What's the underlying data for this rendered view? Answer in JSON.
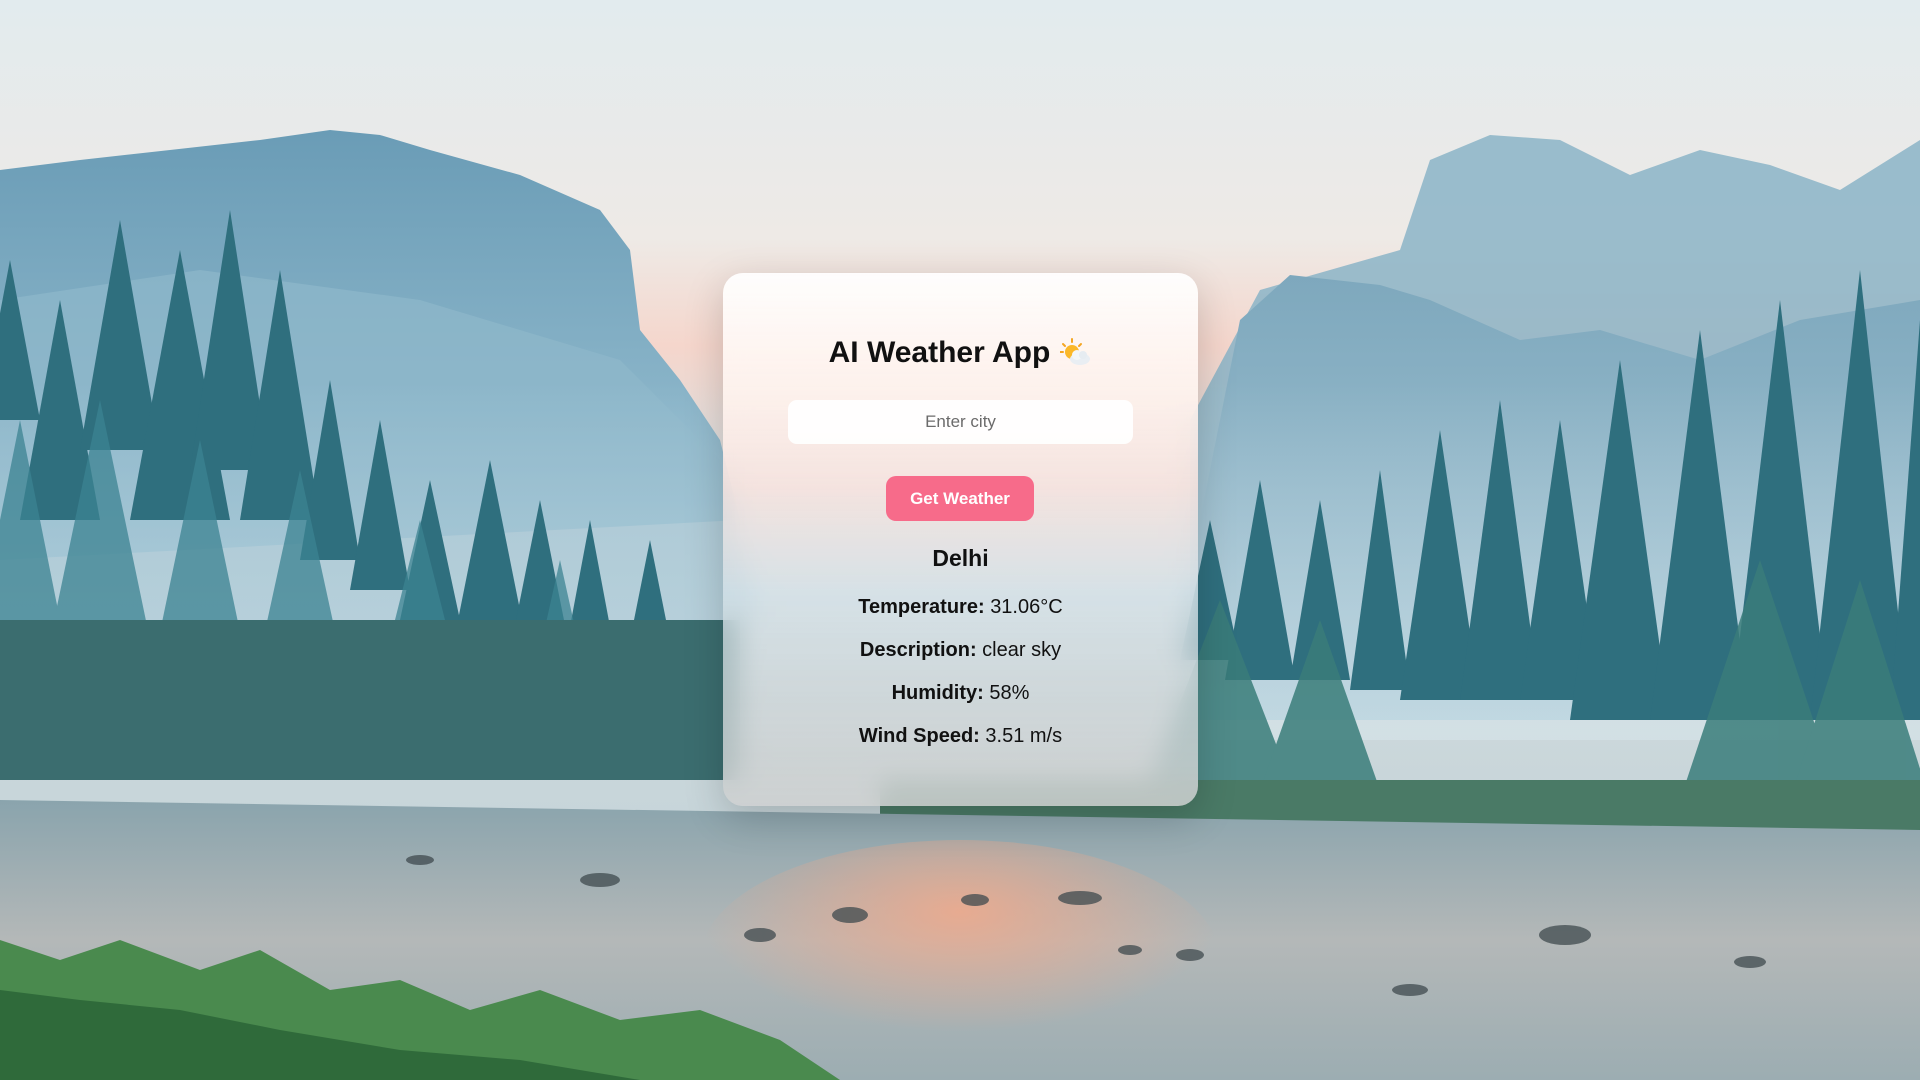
{
  "app": {
    "title": "AI Weather App",
    "title_icon": "sun-behind-cloud-icon"
  },
  "search": {
    "placeholder": "Enter city",
    "value": ""
  },
  "button": {
    "label": "Get Weather",
    "color": "#f76b8a"
  },
  "weather": {
    "city": "Delhi",
    "temperature_label": "Temperature:",
    "temperature_value": "31.06°C",
    "description_label": "Description:",
    "description_value": "clear sky",
    "humidity_label": "Humidity:",
    "humidity_value": "58%",
    "wind_label": "Wind Speed:",
    "wind_value": "3.51 m/s"
  },
  "background": {
    "scene": "misty-mountain-valley-river"
  }
}
